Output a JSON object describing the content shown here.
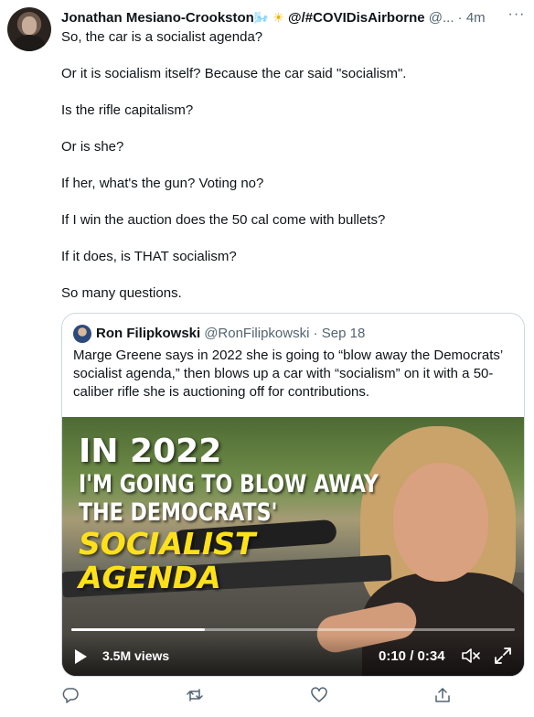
{
  "author": {
    "name": "Jonathan Mesiano-Crookston",
    "name_emoji": "🌬️",
    "sun_emoji": "☀",
    "handle_suffix": " @/#COVIDisAirborne",
    "handle_tail": " @... · 4m"
  },
  "tweet_lines": [
    "So, the car is a socialist agenda?",
    "Or it is socialism itself? Because the car said \"socialism\".",
    "Is the rifle capitalism?",
    "Or is she?",
    "If her, what's the gun? Voting no?",
    "If I win the auction does the 50 cal come with bullets?",
    "If it does, is THAT socialism?",
    "So many questions."
  ],
  "quote": {
    "name": "Ron Filipkowski",
    "meta": "@RonFilipkowski · Sep 18",
    "text": "Marge Greene says in 2022 she is going to “blow away the Democrats’ socialist agenda,” then blows up a car with “socialism” on it with a 50-caliber rifle she is auctioning off for contributions."
  },
  "video": {
    "overlay": [
      "IN 2022",
      "I'M GOING TO BLOW AWAY",
      "THE DEMOCRATS'",
      "SOCIALIST",
      "AGENDA"
    ],
    "views": "3.5M views",
    "time": "0:10 / 0:34",
    "progress": 0.3
  },
  "icons": [
    "more-icon",
    "reply-icon",
    "retweet-icon",
    "like-icon",
    "share-icon",
    "play-icon",
    "mute-icon",
    "fullscreen-icon"
  ],
  "colors": {
    "text": "#0f1419",
    "muted": "#536471",
    "border": "#cfd9de",
    "overlay_yellow": "#ffe11a"
  }
}
